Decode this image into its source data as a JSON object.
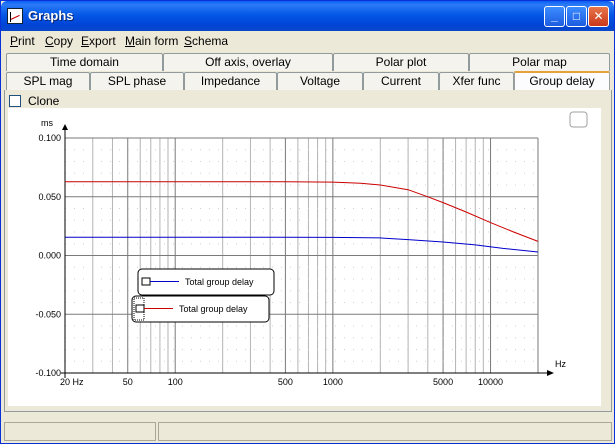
{
  "window": {
    "title": "Graphs"
  },
  "menu": [
    {
      "label": "Print",
      "underline": "P",
      "rest": "rint"
    },
    {
      "label": "Copy",
      "underline": "C",
      "rest": "opy"
    },
    {
      "label": "Export",
      "underline": "E",
      "rest": "xport"
    },
    {
      "label": "Main form",
      "underline": "M",
      "rest": "ain form"
    },
    {
      "label": "Schema",
      "underline": "S",
      "rest": "chema"
    }
  ],
  "tabs_top": [
    "Time domain",
    "Off axis, overlay",
    "Polar plot",
    "Polar map"
  ],
  "tabs_bottom": [
    "SPL mag",
    "SPL phase",
    "Impedance",
    "Voltage",
    "Current",
    "Xfer func",
    "Group delay"
  ],
  "active_tab": "Group delay",
  "clone": {
    "label": "Clone",
    "checked": false
  },
  "chart_data": {
    "type": "line",
    "x_scale": "log",
    "ylabel": "ms",
    "xlabel": "Hz",
    "xlim": [
      20,
      20000
    ],
    "ylim": [
      -0.1,
      0.1
    ],
    "y_ticks": [
      "0.100",
      "0.050",
      "0.000",
      "-0.050",
      "-0.100"
    ],
    "x_ticks": [
      "20 Hz",
      "50",
      "100",
      "500",
      "1000",
      "5000",
      "10000"
    ],
    "grid": true,
    "series": [
      {
        "name": "Total group delay",
        "color": "#0000cc",
        "x": [
          20,
          100,
          500,
          1000,
          2000,
          3000,
          5000,
          8000,
          12000,
          20000
        ],
        "y": [
          0.0155,
          0.0155,
          0.0155,
          0.0154,
          0.015,
          0.0135,
          0.0115,
          0.009,
          0.006,
          0.003
        ]
      },
      {
        "name": "Total group delay",
        "color": "#cc0000",
        "x": [
          20,
          100,
          500,
          1000,
          1500,
          2000,
          3000,
          4000,
          5000,
          7000,
          10000,
          14000,
          20000
        ],
        "y": [
          0.0628,
          0.0628,
          0.0628,
          0.0625,
          0.0615,
          0.06,
          0.056,
          0.05,
          0.045,
          0.037,
          0.028,
          0.02,
          0.012
        ]
      }
    ]
  }
}
